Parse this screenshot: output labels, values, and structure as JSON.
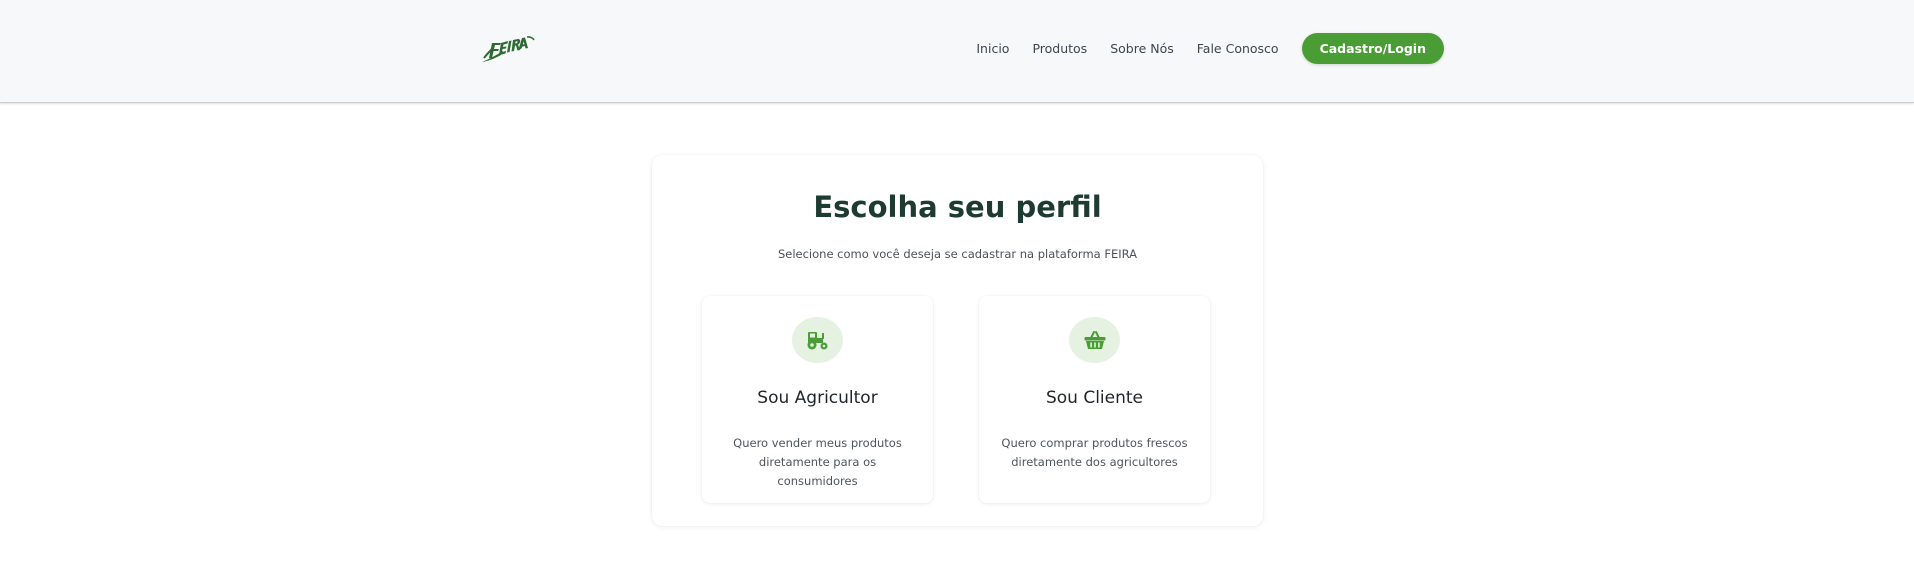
{
  "header": {
    "logo_alt": "FEIRA",
    "nav": [
      {
        "label": "Inicio"
      },
      {
        "label": "Produtos"
      },
      {
        "label": "Sobre Nós"
      },
      {
        "label": "Fale Conosco"
      }
    ],
    "cta_label": "Cadastro/Login"
  },
  "main": {
    "title": "Escolha seu perfil",
    "subtitle": "Selecione como você deseja se cadastrar na plataforma FEIRA",
    "cards": [
      {
        "icon": "tractor-icon",
        "title": "Sou Agricultor",
        "description": "Quero vender meus produtos diretamente para os consumidores"
      },
      {
        "icon": "shopping-basket-icon",
        "title": "Sou Cliente",
        "description": "Quero comprar produtos frescos diretamente dos agricultores"
      }
    ]
  },
  "colors": {
    "brand_green": "#4a9d35",
    "logo_green": "#2e6b33",
    "title_dark": "#1d3b30",
    "icon_bg": "#e5f2e1"
  }
}
